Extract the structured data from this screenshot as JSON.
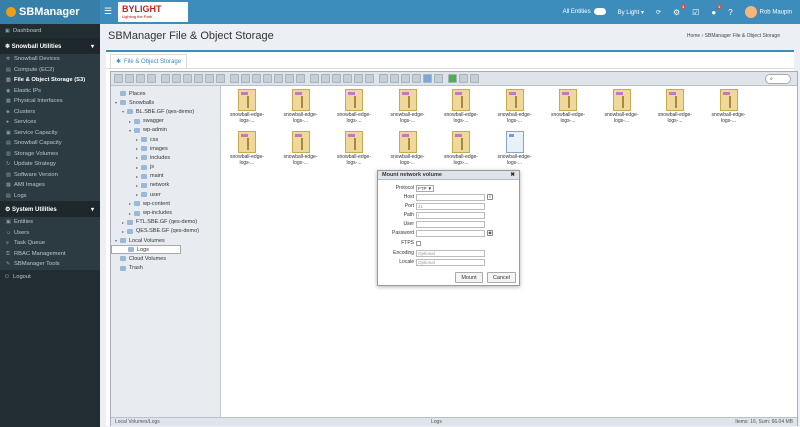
{
  "app": {
    "logo": "SBManager",
    "brand": "BYLIGHT",
    "brand_tag": "Lighting the Path"
  },
  "topbar": {
    "entities": "All Entities",
    "org": "By Light ▾",
    "user": "Rob Maupin",
    "badge_a": "1",
    "badge_b": "1"
  },
  "sidebar": {
    "dashboard": "Dashboard",
    "group1": "Snowball Utilities",
    "group1_items": [
      "Snowball Devices",
      "Compute (EC2)",
      "File & Object Storage (S3)",
      "Elastic IPs",
      "Physical Interfaces",
      "Clusters",
      "Services",
      "Service Capacity",
      "Snowball Capacity",
      "Storage Volumes",
      "Update Strategy",
      "Software Version",
      "AMI Images",
      "Logs"
    ],
    "group2": "System Utilities",
    "group2_items": [
      "Entities",
      "Users",
      "Task Queue",
      "RBAC Management",
      "SBManager Tools"
    ],
    "logout": "Logout"
  },
  "page": {
    "title": "SBManager File & Object Storage",
    "crumb_home": "Home",
    "crumb_sep": "›",
    "crumb_current": "SBManager File & Object Storage",
    "tab": "File & Object Storage"
  },
  "search": {
    "placeholder": ""
  },
  "tree": [
    {
      "label": "Places",
      "arr": "",
      "depth": 0
    },
    {
      "label": "Snowballs",
      "arr": "▾",
      "depth": 0
    },
    {
      "label": "BL.SBE.GF (qes-demo)",
      "arr": "▾",
      "depth": 1
    },
    {
      "label": "swagger",
      "arr": "▸",
      "depth": 2
    },
    {
      "label": "wp-admin",
      "arr": "▾",
      "depth": 2
    },
    {
      "label": "css",
      "arr": "▸",
      "depth": 3
    },
    {
      "label": "images",
      "arr": "▸",
      "depth": 3
    },
    {
      "label": "includes",
      "arr": "▸",
      "depth": 3
    },
    {
      "label": "js",
      "arr": "▸",
      "depth": 3
    },
    {
      "label": "maint",
      "arr": "▸",
      "depth": 3
    },
    {
      "label": "network",
      "arr": "▸",
      "depth": 3
    },
    {
      "label": "user",
      "arr": "▸",
      "depth": 3
    },
    {
      "label": "wp-content",
      "arr": "▸",
      "depth": 2
    },
    {
      "label": "wp-includes",
      "arr": "▸",
      "depth": 2
    },
    {
      "label": "FTL.SBE.GF (qes-demo)",
      "arr": "▸",
      "depth": 1
    },
    {
      "label": "QES.SBE.GF (qes-demo)",
      "arr": "▸",
      "depth": 1
    },
    {
      "label": "Local Volumes",
      "arr": "▾",
      "depth": 0
    },
    {
      "label": "Logs",
      "arr": "",
      "depth": 1
    },
    {
      "label": "Cloud Volumes",
      "arr": "",
      "depth": 0
    },
    {
      "label": "Trash",
      "arr": "",
      "depth": 0
    }
  ],
  "files": [
    "snowball-edge-logs-...",
    "snowball-edge-logs-...",
    "snowball-edge-logs-...",
    "snowball-edge-logs-...",
    "snowball-edge-logs-...",
    "snowball-edge-logs-...",
    "snowball-edge-logs-...",
    "snowball-edge-logs-...",
    "snowball-edge-logs-...",
    "snowball-edge-logs-...",
    "snowball-edge-logs-...",
    "snowball-edge-logs-...",
    "snowball-edge-logs-...",
    "snowball-edge-logs-...",
    "snowball-edge-logs-...",
    "snowball-edge-logs-..."
  ],
  "status": {
    "path": "Local Volumes/Logs",
    "folder": "Logs",
    "summary": "Items: 16, Sum: 66.04 MB"
  },
  "dialog": {
    "title": "Mount network volume",
    "close": "✖",
    "protocol_label": "Protocol",
    "protocol_value": "FTP ▼",
    "host_label": "Host",
    "host_value": "",
    "port_label": "Port",
    "port_value": "21",
    "path_label": "Path",
    "path_value": "/",
    "user_label": "User",
    "user_value": "",
    "password_label": "Password",
    "password_value": "",
    "ftps_label": "FTPS",
    "encoding_label": "Encoding",
    "encoding_placeholder": "Optional",
    "locale_label": "Locale",
    "locale_placeholder": "Optional",
    "mount": "Mount",
    "cancel": "Cancel"
  }
}
